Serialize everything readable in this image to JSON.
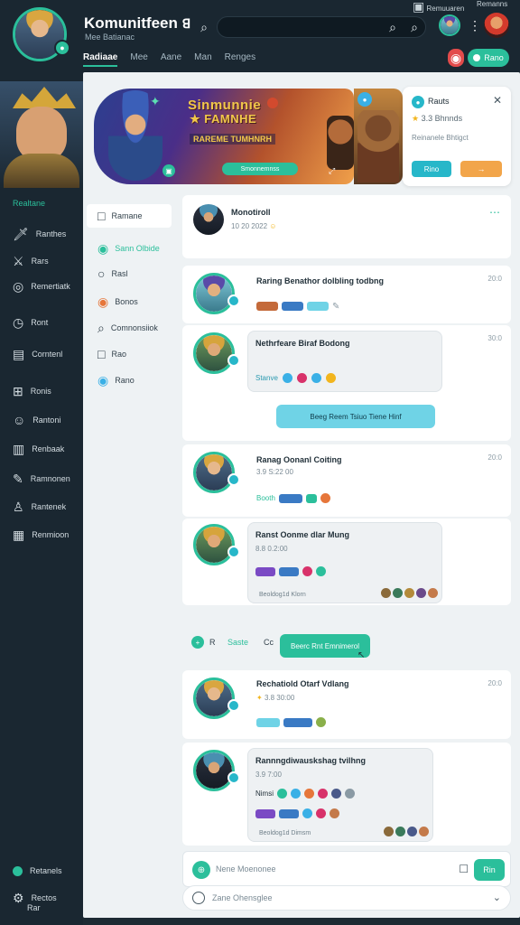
{
  "header": {
    "title": "Komunitfeen",
    "subtitle": "Mee Batianac",
    "title_glyph": "ꓭ",
    "right_status": "Remuuaren",
    "right_status2": "Remanns",
    "nav_tabs": [
      "Radiaae",
      "Mee",
      "Aane",
      "Man",
      "Renges"
    ],
    "active_tab": 0,
    "green_button": "Rano"
  },
  "rail": {
    "section_label": "Realtane",
    "items": [
      {
        "label": "Ranthes",
        "icon": "sword-icon"
      },
      {
        "label": "Rars",
        "icon": "crossed-swords-icon"
      },
      {
        "label": "Remertiatk",
        "icon": "target-icon"
      },
      {
        "label": "Ront",
        "icon": "clock-icon"
      },
      {
        "label": "Corntenl",
        "icon": "book-icon"
      },
      {
        "label": "Ronis",
        "icon": "gamepad-icon"
      },
      {
        "label": "Rantoni",
        "icon": "smile-icon"
      },
      {
        "label": "Renbaak",
        "icon": "book-open-icon"
      },
      {
        "label": "Ramnonen",
        "icon": "pen-icon"
      },
      {
        "label": "Rantenek",
        "icon": "user-icon"
      },
      {
        "label": "Renmioon",
        "icon": "library-icon"
      }
    ],
    "bottom": [
      "Retanels",
      "Rectos",
      "Rar"
    ]
  },
  "banner": {
    "title_line1": "Sinmunnie",
    "title_line2": "FAMNHE",
    "subtitle": "RAREME TUMHNRH",
    "button": "Smonnemnss"
  },
  "infocard": {
    "title": "Rauts",
    "rating": "3.3",
    "rating_text": "Bhnnds",
    "desc": "Reinanele Bhtigct",
    "btn1": "Rino",
    "btn2": "→"
  },
  "sections": {
    "items": [
      {
        "label": "Ramane",
        "icon": "square-icon",
        "color": "#33434d"
      },
      {
        "label": "Sann Olbide",
        "icon": "circle-icon",
        "color": "#2bbf9b"
      },
      {
        "label": "Rasl",
        "icon": "circle-icon",
        "color": "#33434d"
      },
      {
        "label": "Bonos",
        "icon": "circle-icon",
        "color": "#e6763a"
      },
      {
        "label": "Comnonsiiok",
        "icon": "search-icon",
        "color": "#33434d"
      },
      {
        "label": "Rao",
        "icon": "square-icon",
        "color": "#33434d"
      },
      {
        "label": "Rano",
        "icon": "circle-icon",
        "color": "#3ab0e6"
      }
    ]
  },
  "post": {
    "name": "Monotiroll",
    "meta": "10 20 2022"
  },
  "messages": [
    {
      "name": "Raring Benathor dolbling todbng",
      "time": "20:0"
    },
    {
      "name": "Nethrfeare Biraf Bodong",
      "time": "30:0",
      "pill": "Stanve"
    },
    {
      "name": "Ranag Oonanl Coiting",
      "time": "20:0",
      "meta": "3.9 S:22 00",
      "pill": "Booth"
    },
    {
      "name": "Ranst Oonme dlar Mung",
      "time": "",
      "meta": "8.8 0.2:00",
      "footer": "Beoldog1d Klorn"
    },
    {
      "name": "Rechatiold Otarf Vdlang",
      "time": "20:0",
      "meta": "3.8 30:00"
    },
    {
      "name": "Rannngdiwauskshag tvilhng",
      "time": "",
      "meta": "3.9 7:00",
      "pill": "Nimsi",
      "footer": "Beoldog1d Dimsm"
    }
  ],
  "typing": "Beeg Reem Tsiuo Tiene Hinf",
  "divider_row": {
    "label1": "R",
    "label2": "Saste",
    "label3": "Cc",
    "button": "Beerc Rnt Emnimerol"
  },
  "composer": {
    "placeholder": "Nene Moenonee",
    "send": "Rin",
    "bottom_placeholder": "Zane Ohensglee"
  }
}
